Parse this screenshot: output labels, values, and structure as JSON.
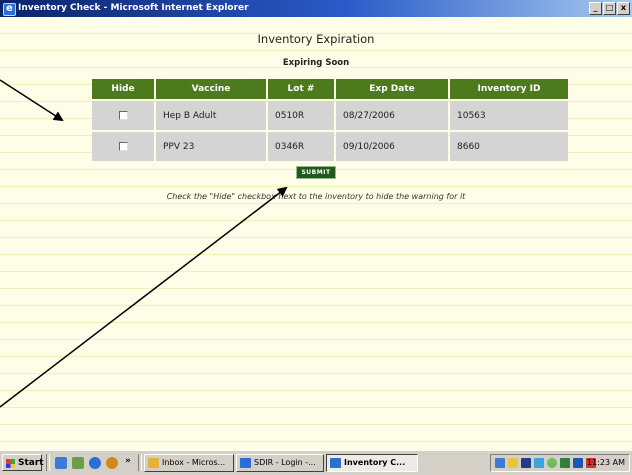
{
  "window": {
    "title": "Inventory Check - Microsoft Internet Explorer",
    "min": "_",
    "max": "□",
    "close": "x"
  },
  "page": {
    "title": "Inventory Expiration",
    "subtitle": "Expiring Soon",
    "columns": [
      "Hide",
      "Vaccine",
      "Lot #",
      "Exp Date",
      "Inventory ID"
    ],
    "rows": [
      {
        "hide": false,
        "vaccine": "Hep B Adult",
        "lot": "0510R",
        "exp_date": "08/27/2006",
        "inventory_id": "10563"
      },
      {
        "hide": false,
        "vaccine": "PPV 23",
        "lot": "0346R",
        "exp_date": "09/10/2006",
        "inventory_id": "8660"
      }
    ],
    "submit_label": "SUBMIT",
    "note": "Check the \"Hide\" checkbox next to the inventory to hide the warning for it"
  },
  "colors": {
    "header_green": "#4e7a1e",
    "row_gray": "#d4d4d4",
    "page_bg": "#fefee8",
    "title_blue": "#0a246a"
  },
  "taskbar": {
    "start_label": "Start",
    "more": "»",
    "tasks": [
      {
        "label": "Inbox - Micros...",
        "icon": "outlook-icon",
        "active": false
      },
      {
        "label": "SDIR - Login -...",
        "icon": "ie-icon",
        "active": false
      },
      {
        "label": "Inventory C...",
        "icon": "ie-icon",
        "active": true
      }
    ],
    "clock": "11:23 AM"
  }
}
